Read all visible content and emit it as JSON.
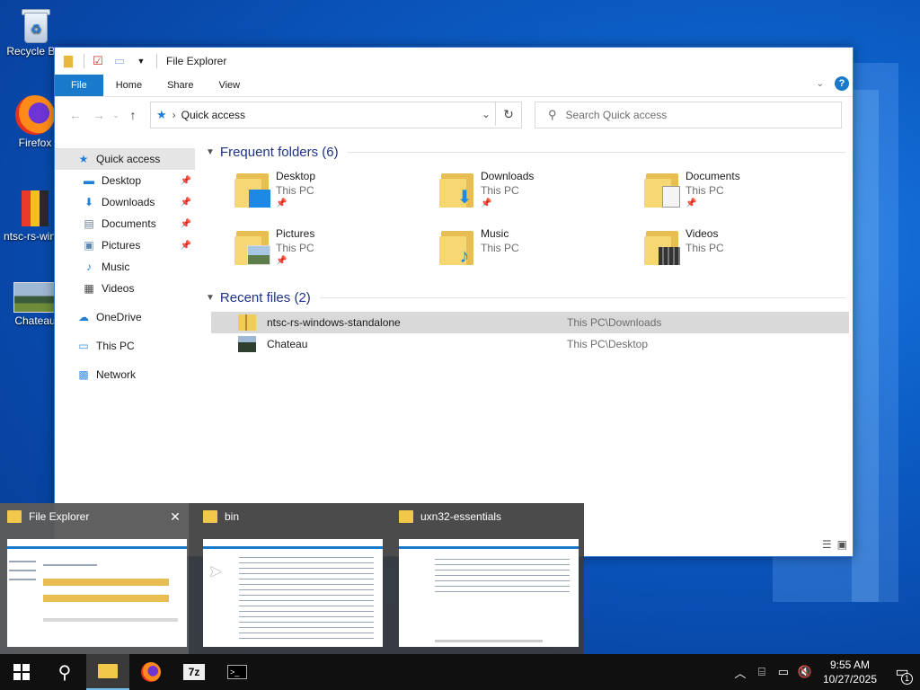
{
  "desktop": {
    "icons": [
      {
        "label": "Recycle Bin"
      },
      {
        "label": "Firefox"
      },
      {
        "label": "ntsc-rs-windows-standalone"
      },
      {
        "label": "Chateau"
      }
    ]
  },
  "window": {
    "title": "File Explorer",
    "ribbon_tabs": [
      "File",
      "Home",
      "Share",
      "View"
    ],
    "address": {
      "location": "Quick access"
    },
    "search": {
      "placeholder": "Search Quick access"
    },
    "nav": [
      {
        "label": "Quick access",
        "icon": "star-icon",
        "pinned": false
      },
      {
        "label": "Desktop",
        "icon": "desktop-icon",
        "pinned": true
      },
      {
        "label": "Downloads",
        "icon": "download-icon",
        "pinned": true
      },
      {
        "label": "Documents",
        "icon": "document-icon",
        "pinned": true
      },
      {
        "label": "Pictures",
        "icon": "picture-icon",
        "pinned": true
      },
      {
        "label": "Music",
        "icon": "music-icon",
        "pinned": false
      },
      {
        "label": "Videos",
        "icon": "video-icon",
        "pinned": false
      },
      {
        "label": "OneDrive",
        "icon": "cloud-icon",
        "pinned": false
      },
      {
        "label": "This PC",
        "icon": "computer-icon",
        "pinned": false
      },
      {
        "label": "Network",
        "icon": "network-icon",
        "pinned": false
      }
    ],
    "frequent": {
      "heading": "Frequent folders (6)",
      "folders": [
        {
          "name": "Desktop",
          "location": "This PC",
          "pinned": true
        },
        {
          "name": "Downloads",
          "location": "This PC",
          "pinned": true
        },
        {
          "name": "Documents",
          "location": "This PC",
          "pinned": true
        },
        {
          "name": "Pictures",
          "location": "This PC",
          "pinned": true
        },
        {
          "name": "Music",
          "location": "This PC",
          "pinned": false
        },
        {
          "name": "Videos",
          "location": "This PC",
          "pinned": false
        }
      ]
    },
    "recent": {
      "heading": "Recent files (2)",
      "files": [
        {
          "name": "ntsc-rs-windows-standalone",
          "path": "This PC\\Downloads"
        },
        {
          "name": "Chateau",
          "path": "This PC\\Desktop"
        }
      ]
    }
  },
  "thumbnails": [
    {
      "title": "File Explorer"
    },
    {
      "title": "bin"
    },
    {
      "title": "uxn32-essentials"
    }
  ],
  "taskbar": {
    "time": "9:55 AM",
    "date": "10/27/2025",
    "notification_count": "1"
  }
}
